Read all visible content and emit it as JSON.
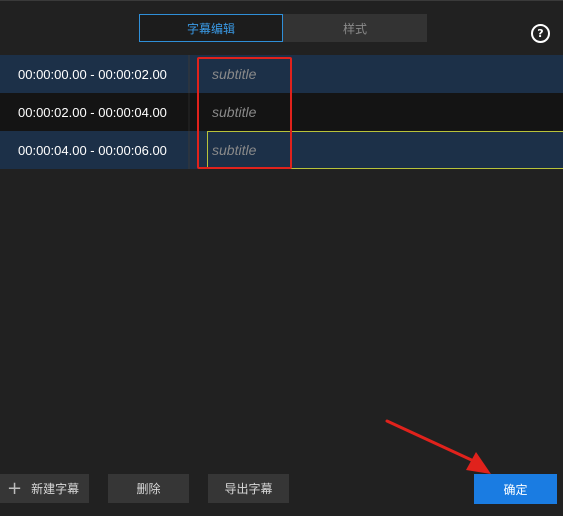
{
  "tabs": {
    "edit": "字幕编辑",
    "style": "样式"
  },
  "help_icon_glyph": "?",
  "rows": [
    {
      "time": "00:00:00.00 - 00:00:02.00",
      "text": "subtitle"
    },
    {
      "time": "00:00:02.00 - 00:00:04.00",
      "text": "subtitle"
    },
    {
      "time": "00:00:04.00 - 00:00:06.00",
      "text": "subtitle"
    }
  ],
  "buttons": {
    "new": "新建字幕",
    "plus_glyph": "+",
    "delete": "删除",
    "export": "导出字幕",
    "confirm": "确定"
  },
  "colors": {
    "accent": "#1a7ce2",
    "annotation": "#e0221c",
    "row_highlight": "#1c3048"
  }
}
